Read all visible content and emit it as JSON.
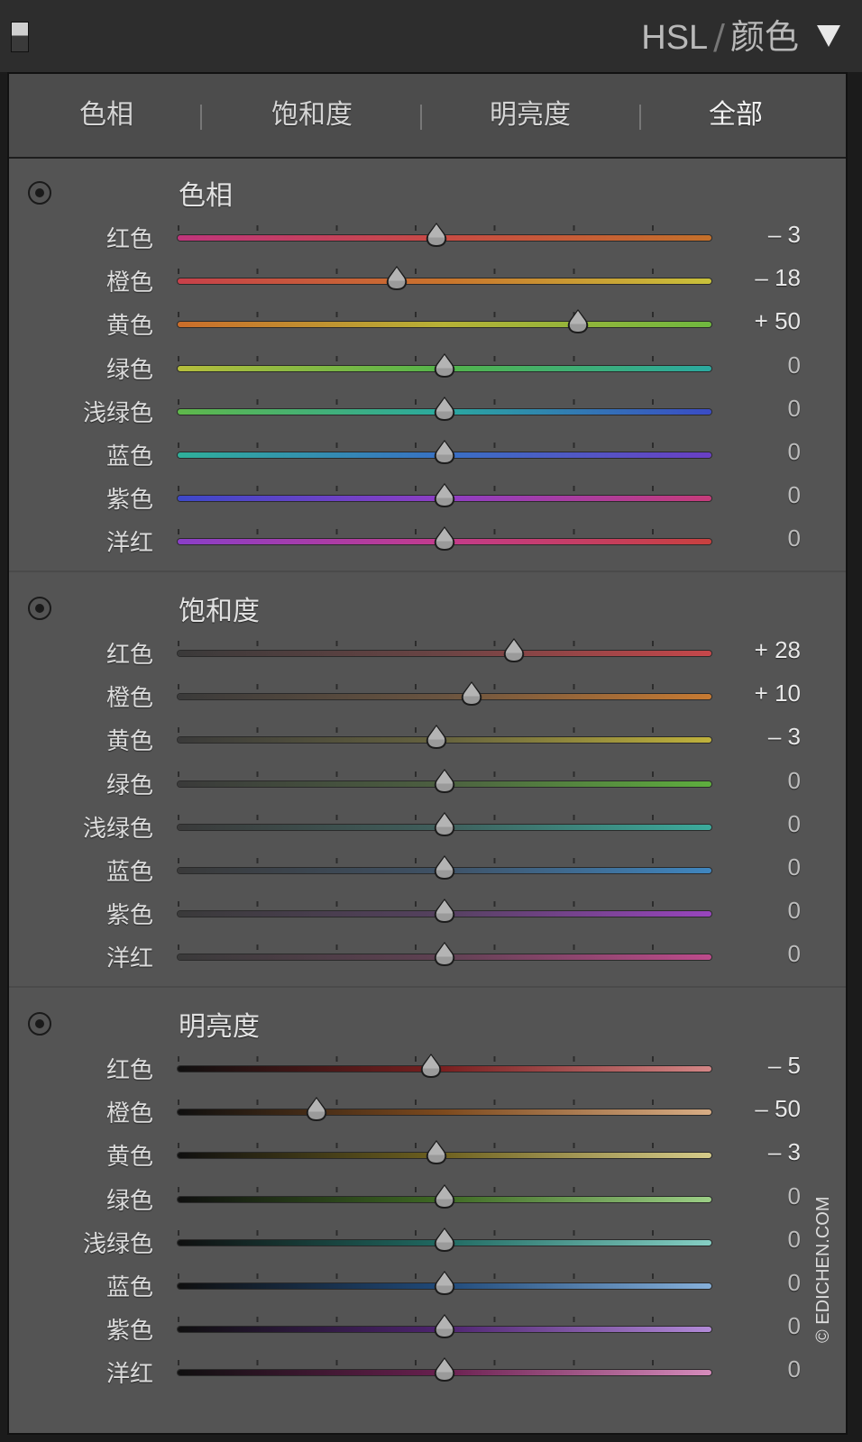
{
  "header": {
    "title_latin": "HSL",
    "separator": "/",
    "title_cjk": "颜色"
  },
  "tabs": [
    {
      "label": "色相",
      "active": false
    },
    {
      "label": "饱和度",
      "active": false
    },
    {
      "label": "明亮度",
      "active": false
    },
    {
      "label": "全部",
      "active": true
    }
  ],
  "sections": [
    {
      "title": "色相",
      "rows": [
        {
          "label": "红色",
          "value": "– 3",
          "fraction": 0.485,
          "colors": [
            "#c0357c",
            "#c84b43",
            "#c4702a"
          ]
        },
        {
          "label": "橙色",
          "value": "– 18",
          "fraction": 0.41,
          "colors": [
            "#c8404a",
            "#c9742c",
            "#c9c23a"
          ]
        },
        {
          "label": "黄色",
          "value": "+ 50",
          "fraction": 0.75,
          "colors": [
            "#cb6d2a",
            "#b7b236",
            "#6fb83f"
          ]
        },
        {
          "label": "绿色",
          "value": "0",
          "fraction": 0.5,
          "colors": [
            "#b6be3c",
            "#53b44a",
            "#2aa9a0"
          ]
        },
        {
          "label": "浅绿色",
          "value": "0",
          "fraction": 0.5,
          "colors": [
            "#5fb84a",
            "#2aa9a0",
            "#3a4bc6"
          ]
        },
        {
          "label": "蓝色",
          "value": "0",
          "fraction": 0.5,
          "colors": [
            "#2fb09a",
            "#3870c4",
            "#6a3fc4"
          ]
        },
        {
          "label": "紫色",
          "value": "0",
          "fraction": 0.5,
          "colors": [
            "#3d48c8",
            "#8e3ec4",
            "#c63c7a"
          ]
        },
        {
          "label": "洋红",
          "value": "0",
          "fraction": 0.5,
          "colors": [
            "#8a3ec8",
            "#c43b8c",
            "#c8403e"
          ]
        }
      ]
    },
    {
      "title": "饱和度",
      "rows": [
        {
          "label": "红色",
          "value": "+ 28",
          "fraction": 0.63,
          "colors": [
            "#3a3a3a",
            "#6b4444",
            "#c6474a"
          ]
        },
        {
          "label": "橙色",
          "value": "+ 10",
          "fraction": 0.55,
          "colors": [
            "#3a3a3a",
            "#6a5440",
            "#c77a32"
          ]
        },
        {
          "label": "黄色",
          "value": "– 3",
          "fraction": 0.485,
          "colors": [
            "#3a3a3a",
            "#66633e",
            "#c0b23c"
          ]
        },
        {
          "label": "绿色",
          "value": "0",
          "fraction": 0.5,
          "colors": [
            "#3a3a3a",
            "#4c6040",
            "#5eae3e"
          ]
        },
        {
          "label": "浅绿色",
          "value": "0",
          "fraction": 0.5,
          "colors": [
            "#3a3a3a",
            "#3f5f5c",
            "#3bab9c"
          ]
        },
        {
          "label": "蓝色",
          "value": "0",
          "fraction": 0.5,
          "colors": [
            "#3a3a3a",
            "#3f5266",
            "#3f86c0"
          ]
        },
        {
          "label": "紫色",
          "value": "0",
          "fraction": 0.5,
          "colors": [
            "#3a3a3a",
            "#55415f",
            "#9845be"
          ]
        },
        {
          "label": "洋红",
          "value": "0",
          "fraction": 0.5,
          "colors": [
            "#3a3a3a",
            "#5f4152",
            "#be4b8c"
          ]
        }
      ]
    },
    {
      "title": "明亮度",
      "rows": [
        {
          "label": "红色",
          "value": "– 5",
          "fraction": 0.475,
          "colors": [
            "#0f0f0f",
            "#7a2020",
            "#d48686"
          ]
        },
        {
          "label": "橙色",
          "value": "– 50",
          "fraction": 0.26,
          "colors": [
            "#0f0f0f",
            "#7d4a1e",
            "#d8ad85"
          ]
        },
        {
          "label": "黄色",
          "value": "– 3",
          "fraction": 0.485,
          "colors": [
            "#0f0f0f",
            "#6f6220",
            "#d6cc8a"
          ]
        },
        {
          "label": "绿色",
          "value": "0",
          "fraction": 0.5,
          "colors": [
            "#0f0f0f",
            "#3f6a24",
            "#9ccf86"
          ]
        },
        {
          "label": "浅绿色",
          "value": "0",
          "fraction": 0.5,
          "colors": [
            "#0f0f0f",
            "#206a62",
            "#86cfc4"
          ]
        },
        {
          "label": "蓝色",
          "value": "0",
          "fraction": 0.5,
          "colors": [
            "#0f0f0f",
            "#204a7a",
            "#86b0da"
          ]
        },
        {
          "label": "紫色",
          "value": "0",
          "fraction": 0.5,
          "colors": [
            "#0f0f0f",
            "#4e2470",
            "#b28ad8"
          ]
        },
        {
          "label": "洋红",
          "value": "0",
          "fraction": 0.5,
          "colors": [
            "#0f0f0f",
            "#6a2050",
            "#d68cbc"
          ]
        }
      ]
    }
  ],
  "watermark": "© EDICHEN.COM"
}
